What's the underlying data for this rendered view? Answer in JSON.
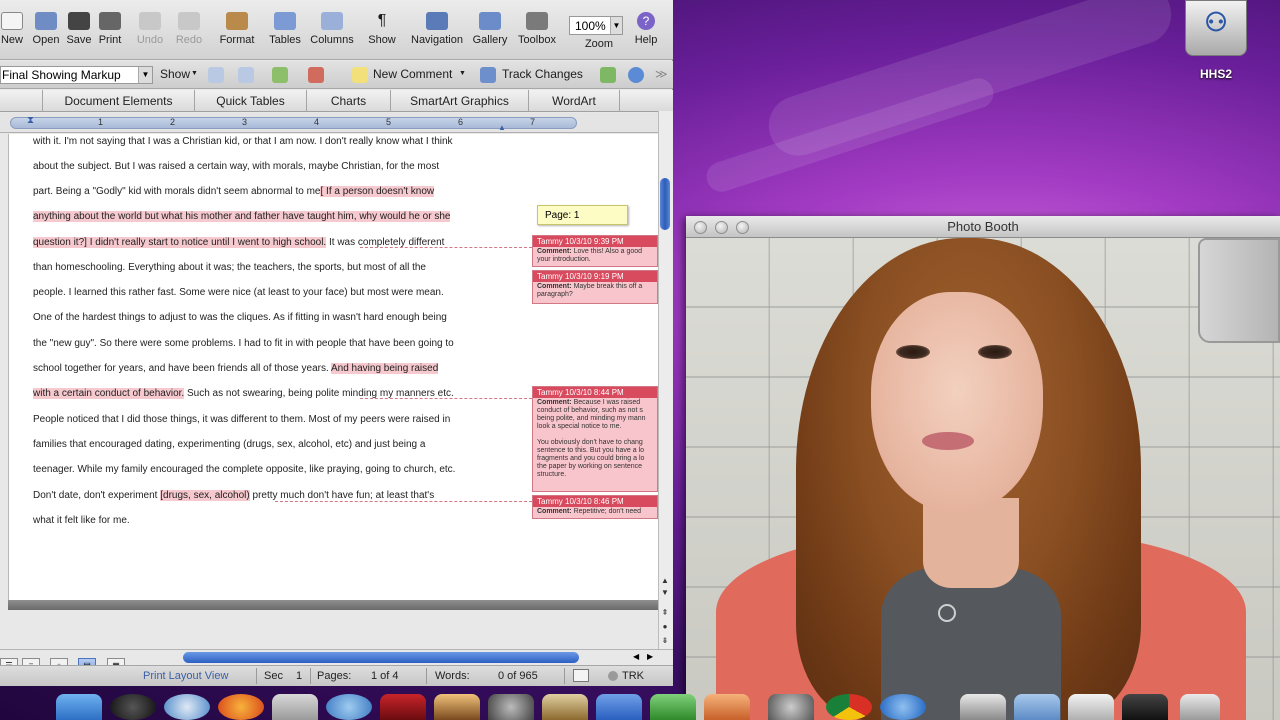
{
  "word": {
    "toolbar": {
      "items": [
        {
          "label": "New",
          "icon": "new-document-icon",
          "enabled": true
        },
        {
          "label": "Open",
          "icon": "open-folder-icon",
          "enabled": true
        },
        {
          "label": "Save",
          "icon": "save-icon",
          "enabled": true
        },
        {
          "label": "Print",
          "icon": "printer-icon",
          "enabled": true
        },
        {
          "label": "Undo",
          "icon": "undo-icon",
          "enabled": false
        },
        {
          "label": "Redo",
          "icon": "redo-icon",
          "enabled": false
        },
        {
          "label": "Format",
          "icon": "format-brush-icon",
          "enabled": true
        },
        {
          "label": "Tables",
          "icon": "table-icon",
          "enabled": true
        },
        {
          "label": "Columns",
          "icon": "columns-icon",
          "enabled": true
        },
        {
          "label": "Show",
          "icon": "pilcrow-icon",
          "enabled": true
        },
        {
          "label": "Navigation",
          "icon": "navigation-pane-icon",
          "enabled": true
        },
        {
          "label": "Gallery",
          "icon": "gallery-icon",
          "enabled": true
        },
        {
          "label": "Toolbox",
          "icon": "toolbox-icon",
          "enabled": true
        },
        {
          "label": "Zoom",
          "icon": "zoom-icon",
          "enabled": true
        },
        {
          "label": "Help",
          "icon": "help-icon",
          "enabled": true
        }
      ],
      "zoom_value": "100%"
    },
    "review_bar": {
      "markup_mode": "Final Showing Markup",
      "show_label": "Show",
      "new_comment_label": "New Comment",
      "track_changes_label": "Track Changes"
    },
    "ribbon_tabs": [
      "Document Elements",
      "Quick Tables",
      "Charts",
      "SmartArt Graphics",
      "WordArt"
    ],
    "ruler_numbers": [
      "1",
      "2",
      "3",
      "4",
      "5",
      "6",
      "7"
    ],
    "document": {
      "lines": [
        [
          "with it. I'm not saying that I was a Christian kid, or that I am now. I don't really know what I think"
        ],
        [
          "about the subject. But I was raised a certain way, with morals, maybe Christian, for the most"
        ],
        [
          "part. Being a \"Godly\" kid with morals didn't seem abnormal to me",
          "[ If a person doesn't know"
        ],
        [
          "anything about the world but what his mother and father have taught him, why would he or she"
        ],
        [
          "question it?",
          "] I didn't really start to notice until I went to high school.",
          "It was completely different"
        ],
        [
          "than homeschooling. Everything about it was; the teachers, the sports, but most of all the"
        ],
        [
          "people. I learned this rather fast. Some were nice (at least to your face) but most were mean."
        ],
        [
          "One of the hardest things to adjust to was the cliques. As if fitting in wasn't hard enough being"
        ],
        [
          "the \"new guy\". So there were some problems. I had to fit in with people that have been going to"
        ],
        [
          "school together for years, and have been friends all of those years.",
          "And having being raised"
        ],
        [
          "with a certain conduct of behavior.",
          "Such as not swearing, being polite minding my manners etc."
        ],
        [
          "People noticed that I did those things, it was different to them. Most of my peers were raised in"
        ],
        [
          "families that encouraged dating, experimenting (drugs, sex, alcohol, etc) and just being a"
        ],
        [
          "teenager. While my family encouraged the complete opposite, like praying, going to church, etc."
        ],
        [
          "Don't date, don't experiment",
          "[drugs, sex, alcohol)",
          "pretty much don't have fun; at least that's"
        ],
        [
          "what it felt like for me."
        ]
      ]
    },
    "page_tooltip": "Page: 1",
    "comments": [
      {
        "header": "Tammy 10/3/10 9:39 PM",
        "body_label": "Comment:",
        "body": "Love this! Also a good your introduction."
      },
      {
        "header": "Tammy 10/3/10 9:19 PM",
        "body_label": "Comment:",
        "body": "Maybe break this off a paragraph?"
      },
      {
        "header": "Tammy 10/3/10 8:44 PM",
        "body_label": "Comment:",
        "body": "Because I was raised conduct of behavior, such as not s being polite, and minding my mann look a special notice to me.\n\nYou obviously don't have to chang sentence to this. But you have a lo fragments and you could bring a lo the paper by working on sentence structure."
      },
      {
        "header": "Tammy 10/3/10 8:46 PM",
        "body_label": "Comment:",
        "body": "Repetitive; don't need"
      }
    ],
    "status_bar": {
      "view": "Print Layout View",
      "sec_label": "Sec",
      "sec_value": "1",
      "pages_label": "Pages:",
      "pages_value": "1 of 4",
      "words_label": "Words:",
      "words_value": "0 of 965",
      "trk_label": "TRK"
    }
  },
  "desktop": {
    "drive_label": "HHS2"
  },
  "photo_booth": {
    "title": "Photo Booth"
  },
  "colors": {
    "comment_header": "#d84a5e",
    "comment_body": "#f7c5cb",
    "markup_highlight": "#f6c9cf",
    "scroll_accent": "#2c5db8",
    "desktop_purple": "#6a1f9a"
  }
}
